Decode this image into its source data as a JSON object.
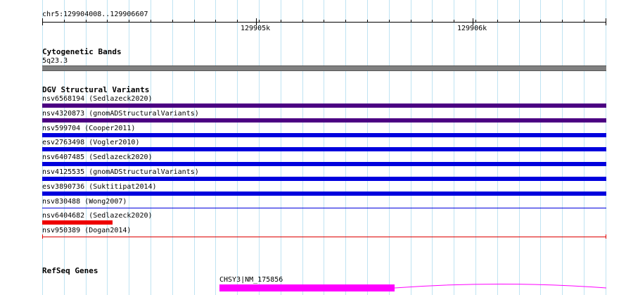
{
  "ruler": {
    "range_label": "chr5:129904008..129906607",
    "ticks": [
      "129905k",
      "129906k"
    ]
  },
  "tracks": {
    "cytoband": {
      "title": "Cytogenetic Bands",
      "band_label": "5q23.3",
      "color": "#808080"
    },
    "dgv": {
      "title": "DGV Structural Variants",
      "variants": [
        {
          "label": "nsv6568194 (Sedlazeck2020)",
          "color": "#4b0082",
          "style": "thick"
        },
        {
          "label": "nsv4320873 (gnomADStructuralVariants)",
          "color": "#4b0082",
          "style": "thick"
        },
        {
          "label": "nsv599704 (Cooper2011)",
          "color": "#0000dd",
          "style": "thick"
        },
        {
          "label": "esv2763498 (Vogler2010)",
          "color": "#0000dd",
          "style": "thick"
        },
        {
          "label": "nsv6407485 (Sedlazeck2020)",
          "color": "#0000dd",
          "style": "thick"
        },
        {
          "label": "nsv4125535 (gnomADStructuralVariants)",
          "color": "#0000dd",
          "style": "thick"
        },
        {
          "label": "esv3890736 (Suktitipat2014)",
          "color": "#0000dd",
          "style": "thick"
        },
        {
          "label": "nsv830488 (Wong2007)",
          "color": "#0000dd",
          "style": "thin"
        },
        {
          "label": "nsv6404682 (Sedlazeck2020)",
          "color": "#ee0000",
          "style": "short"
        },
        {
          "label": "nsv950389 (Dogan2014)",
          "color": "#dd0000",
          "style": "thin-ends"
        }
      ]
    },
    "refseq": {
      "title": "RefSeq Genes",
      "gene_label": "CHSY3|NM_175856",
      "color": "#ff00ff"
    }
  }
}
